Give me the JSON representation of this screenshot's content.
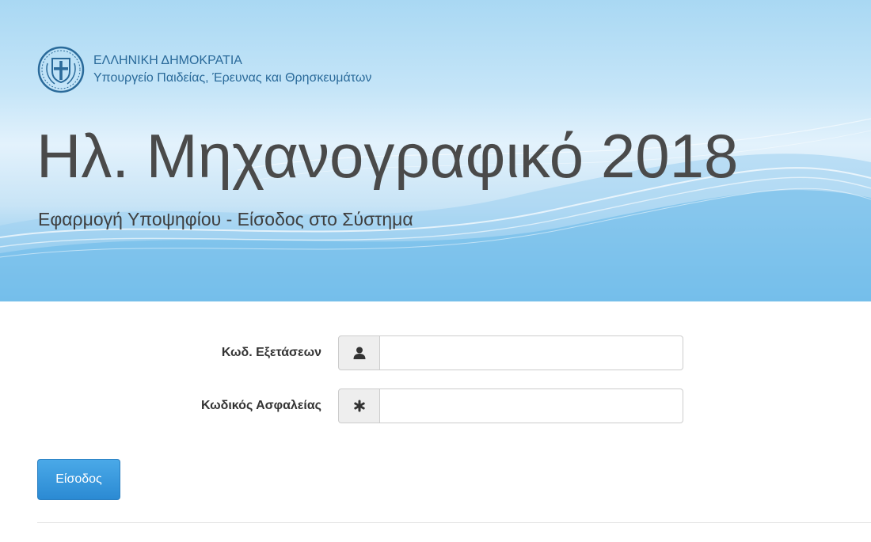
{
  "header": {
    "country": "ΕΛΛΗΝΙΚΗ ΔΗΜΟΚΡΑΤΙΑ",
    "ministry": "Υπουργείο Παιδείας, Έρευνας και Θρησκευμάτων",
    "title": "Ηλ. Μηχανογραφικό 2018",
    "subtitle": "Εφαρμογή Υποψηφίου - Είσοδος στο Σύστημα",
    "emblem_icon": "greek-coat-of-arms-icon"
  },
  "form": {
    "exam_code": {
      "label": "Κωδ. Εξετάσεων",
      "value": "",
      "placeholder": "",
      "icon": "user-icon"
    },
    "security_code": {
      "label": "Κωδικός Ασφαλείας",
      "value": "",
      "placeholder": "",
      "icon": "asterisk-icon"
    },
    "submit_label": "Είσοδος"
  },
  "colors": {
    "primary_button": "#2b8ad3",
    "banner_blue": "#5fb5e7",
    "title_text": "#4a4a4a",
    "ministry_text": "#2a6a9a"
  }
}
